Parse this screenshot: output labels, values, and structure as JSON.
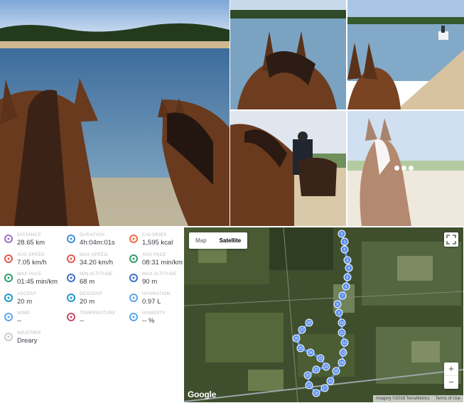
{
  "stats": [
    {
      "label": "DISTANCE",
      "value": "28.65 km",
      "icon": "route-icon",
      "color": "#9b72c7"
    },
    {
      "label": "DURATION",
      "value": "4h:04m:01s",
      "icon": "stopwatch-icon",
      "color": "#3d8fe0"
    },
    {
      "label": "CALORIES",
      "value": "1,595 kcal",
      "icon": "flame-icon",
      "color": "#f26b3a"
    },
    {
      "label": "AVG SPEED",
      "value": "7.05 km/h",
      "icon": "speedometer-icon",
      "color": "#e8574a"
    },
    {
      "label": "MAX SPEED",
      "value": "34.20 km/h",
      "icon": "speedometer-icon",
      "color": "#e8574a"
    },
    {
      "label": "AVG PACE",
      "value": "08:31 min/km",
      "icon": "pace-gauge-icon",
      "color": "#2e9e6a"
    },
    {
      "label": "MAX PACE",
      "value": "01:45 min/km",
      "icon": "pace-gauge-icon",
      "color": "#2e9e6a"
    },
    {
      "label": "MIN ALTITUDE",
      "value": "68 m",
      "icon": "mountain-icon",
      "color": "#3b6fc4"
    },
    {
      "label": "MAX ALTITUDE",
      "value": "90 m",
      "icon": "mountain-icon",
      "color": "#3b6fc4"
    },
    {
      "label": "ASCENT",
      "value": "20 m",
      "icon": "ascent-icon",
      "color": "#1b9ac9"
    },
    {
      "label": "DESCENT",
      "value": "20 m",
      "icon": "descent-icon",
      "color": "#1b9ac9"
    },
    {
      "label": "HYDRATION",
      "value": "0.97 L",
      "icon": "water-drops-icon",
      "color": "#5aa6e8"
    },
    {
      "label": "WIND",
      "value": "--",
      "icon": "wind-icon",
      "color": "#5aa6e8"
    },
    {
      "label": "TEMPERATURE",
      "value": "--",
      "icon": "thermometer-icon",
      "color": "#c74a6a"
    },
    {
      "label": "HUMIDITY",
      "value": "-- %",
      "icon": "humidity-icon",
      "color": "#5aa6e8"
    },
    {
      "label": "WEATHER",
      "value": "Dreary",
      "icon": "cloud-icon",
      "color": "#c8ccd2"
    }
  ],
  "map": {
    "toggle_map": "Map",
    "toggle_satellite": "Satellite",
    "selected": "Satellite",
    "zoom_in": "+",
    "zoom_out": "−",
    "logo": "Google",
    "imagery": "Imagery ©2018 TerraMetrics",
    "terms": "Terms of Use",
    "route_color": "#5b8ff0",
    "waypoints": [
      "0",
      "1",
      "2",
      "3",
      "4",
      "5",
      "6",
      "7",
      "8",
      "9",
      "10",
      "11",
      "12",
      "13",
      "14",
      "15",
      "16",
      "17",
      "18",
      "19",
      "20",
      "21",
      "22",
      "23",
      "24",
      "25",
      "26",
      "27",
      "28"
    ]
  }
}
